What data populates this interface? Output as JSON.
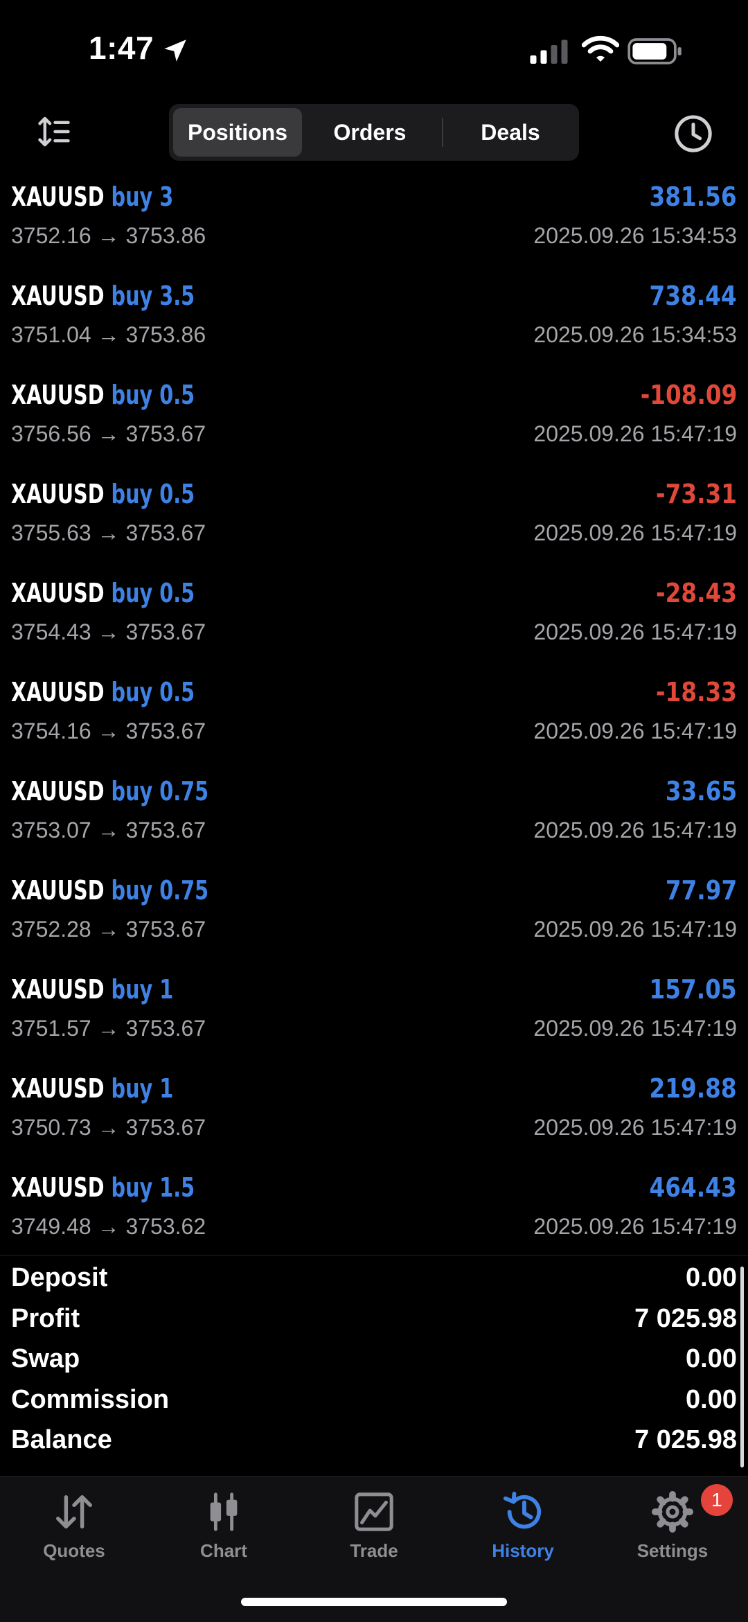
{
  "status_bar": {
    "time": "1:47"
  },
  "header": {
    "tabs": [
      "Positions",
      "Orders",
      "Deals"
    ],
    "active_tab": "Positions"
  },
  "deals": [
    {
      "symbol": "XAUUSD",
      "side": "buy 3",
      "prices": "3752.16 → 3753.86",
      "profit": "381.56",
      "time": "2025.09.26 15:34:53",
      "sign": "pos"
    },
    {
      "symbol": "XAUUSD",
      "side": "buy 3.5",
      "prices": "3751.04 → 3753.86",
      "profit": "738.44",
      "time": "2025.09.26 15:34:53",
      "sign": "pos"
    },
    {
      "symbol": "XAUUSD",
      "side": "buy 0.5",
      "prices": "3756.56 → 3753.67",
      "profit": "-108.09",
      "time": "2025.09.26 15:47:19",
      "sign": "neg"
    },
    {
      "symbol": "XAUUSD",
      "side": "buy 0.5",
      "prices": "3755.63 → 3753.67",
      "profit": "-73.31",
      "time": "2025.09.26 15:47:19",
      "sign": "neg"
    },
    {
      "symbol": "XAUUSD",
      "side": "buy 0.5",
      "prices": "3754.43 → 3753.67",
      "profit": "-28.43",
      "time": "2025.09.26 15:47:19",
      "sign": "neg"
    },
    {
      "symbol": "XAUUSD",
      "side": "buy 0.5",
      "prices": "3754.16 → 3753.67",
      "profit": "-18.33",
      "time": "2025.09.26 15:47:19",
      "sign": "neg"
    },
    {
      "symbol": "XAUUSD",
      "side": "buy 0.75",
      "prices": "3753.07 → 3753.67",
      "profit": "33.65",
      "time": "2025.09.26 15:47:19",
      "sign": "pos"
    },
    {
      "symbol": "XAUUSD",
      "side": "buy 0.75",
      "prices": "3752.28 → 3753.67",
      "profit": "77.97",
      "time": "2025.09.26 15:47:19",
      "sign": "pos"
    },
    {
      "symbol": "XAUUSD",
      "side": "buy 1",
      "prices": "3751.57 → 3753.67",
      "profit": "157.05",
      "time": "2025.09.26 15:47:19",
      "sign": "pos"
    },
    {
      "symbol": "XAUUSD",
      "side": "buy 1",
      "prices": "3750.73 → 3753.67",
      "profit": "219.88",
      "time": "2025.09.26 15:47:19",
      "sign": "pos"
    },
    {
      "symbol": "XAUUSD",
      "side": "buy 1.5",
      "prices": "3749.48 → 3753.62",
      "profit": "464.43",
      "time": "2025.09.26 15:47:19",
      "sign": "pos"
    }
  ],
  "summary": [
    {
      "label": "Deposit",
      "value": "0.00"
    },
    {
      "label": "Profit",
      "value": "7 025.98"
    },
    {
      "label": "Swap",
      "value": "0.00"
    },
    {
      "label": "Commission",
      "value": "0.00"
    },
    {
      "label": "Balance",
      "value": "7 025.98"
    }
  ],
  "tabbar": {
    "items": [
      {
        "label": "Quotes",
        "icon": "quotes-arrows-icon"
      },
      {
        "label": "Chart",
        "icon": "candlestick-icon"
      },
      {
        "label": "Trade",
        "icon": "trade-chart-icon"
      },
      {
        "label": "History",
        "icon": "history-clock-icon"
      },
      {
        "label": "Settings",
        "icon": "gear-icon"
      }
    ],
    "active": "History",
    "settings_badge": "1"
  },
  "colors": {
    "accent_blue": "#3f82e6",
    "loss_red": "#e0493a",
    "secondary_text": "#a5a5aa",
    "badge_red": "#e5443c"
  }
}
